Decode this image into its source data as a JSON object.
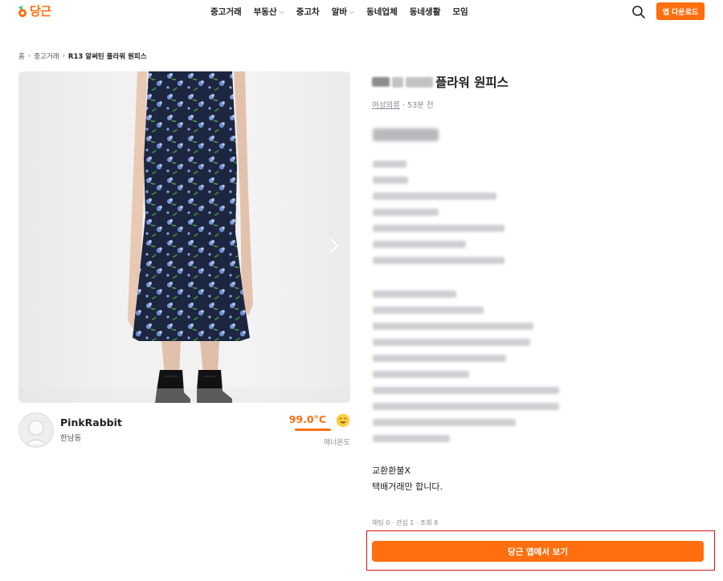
{
  "header": {
    "logo_text": "당근",
    "nav": [
      {
        "label": "중고거래",
        "dropdown": false
      },
      {
        "label": "부동산",
        "dropdown": true
      },
      {
        "label": "중고차",
        "dropdown": false
      },
      {
        "label": "알바",
        "dropdown": true
      },
      {
        "label": "동네업체",
        "dropdown": false
      },
      {
        "label": "동네생활",
        "dropdown": false
      },
      {
        "label": "모임",
        "dropdown": false
      }
    ],
    "download_label": "앱 다운로드"
  },
  "breadcrumb": {
    "home": "홈",
    "category": "중고거래",
    "current": "R13 알써틴 플라워 원피스"
  },
  "seller": {
    "name": "PinkRabbit",
    "region": "한남동",
    "temperature": "99.0°C",
    "temperature_label": "매너온도",
    "temperature_fill": 0.99
  },
  "product": {
    "title_visible": "플라워 원피스",
    "category": "여성의류",
    "time_ago": "· 53분 전",
    "notes": [
      "교환환불X",
      "택배거래만 합니다."
    ],
    "stats": "채팅 0 · 관심 1 · 조회 8"
  },
  "gallery": {
    "dot_count": 5,
    "active_dot": 0
  },
  "cta_label": "당근 앱에서 보기",
  "colors": {
    "brand": "#ff6f0f",
    "highlight_border": "#d4141b"
  },
  "icons": {
    "search": "search-icon",
    "next": "chevron-right-icon",
    "temperature_face": "smile-icon"
  }
}
